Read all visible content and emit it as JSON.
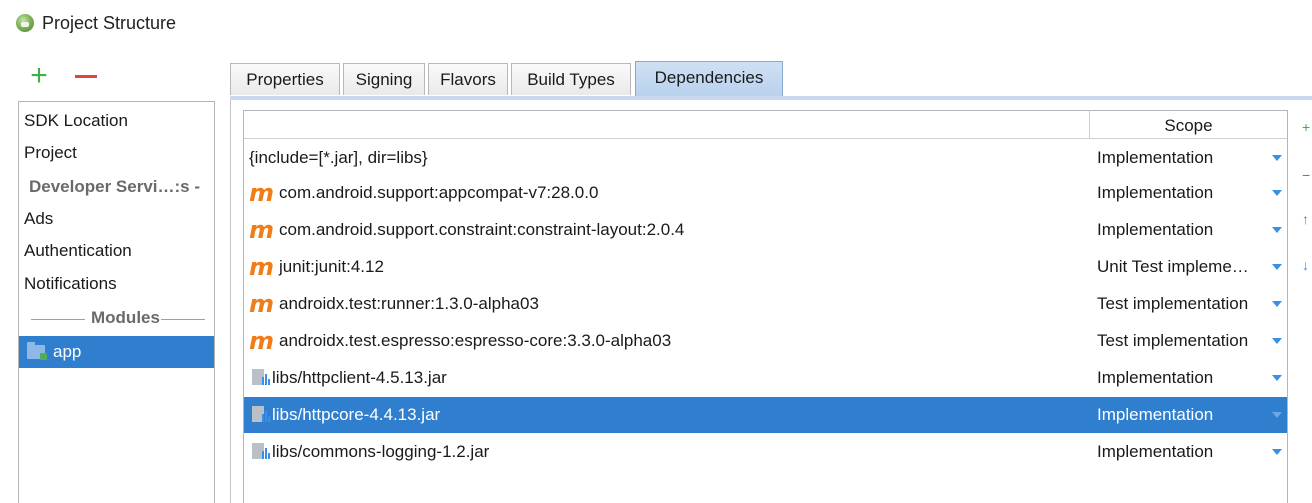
{
  "window": {
    "title": "Project Structure"
  },
  "left_toolbar": {
    "add_symbol": "+",
    "remove_symbol": "−"
  },
  "sidebar": {
    "items": [
      {
        "label": "SDK Location"
      },
      {
        "label": "Project"
      }
    ],
    "group": {
      "label": "Developer Servi…:s -"
    },
    "service_items": [
      {
        "label": "Ads"
      },
      {
        "label": "Authentication"
      },
      {
        "label": "Notifications"
      }
    ],
    "modules_label": "Modules",
    "modules": [
      {
        "label": "app",
        "selected": true
      }
    ]
  },
  "tabs": [
    {
      "label": "Properties",
      "active": false
    },
    {
      "label": "Signing",
      "active": false
    },
    {
      "label": "Flavors",
      "active": false
    },
    {
      "label": "Build Types",
      "active": false
    },
    {
      "label": "Dependencies",
      "active": true
    }
  ],
  "table": {
    "columns": {
      "name": "",
      "scope": "Scope"
    },
    "rows": [
      {
        "icon": "none",
        "name": "{include=[*.jar], dir=libs}",
        "scope": "Implementation",
        "selected": false
      },
      {
        "icon": "maven-icon",
        "name": "com.android.support:appcompat-v7:28.0.0",
        "scope": "Implementation",
        "selected": false
      },
      {
        "icon": "maven-icon",
        "name": "com.android.support.constraint:constraint-layout:2.0.4",
        "scope": "Implementation",
        "selected": false
      },
      {
        "icon": "maven-icon",
        "name": "junit:junit:4.12",
        "scope": "Unit Test impleme…",
        "selected": false
      },
      {
        "icon": "maven-icon",
        "name": "androidx.test:runner:1.3.0-alpha03",
        "scope": "Test implementation",
        "selected": false
      },
      {
        "icon": "maven-icon",
        "name": "androidx.test.espresso:espresso-core:3.3.0-alpha03",
        "scope": "Test implementation",
        "selected": false
      },
      {
        "icon": "jar-icon",
        "name": "libs/httpclient-4.5.13.jar",
        "scope": "Implementation",
        "selected": false
      },
      {
        "icon": "jar-icon",
        "name": "libs/httpcore-4.4.13.jar",
        "scope": "Implementation",
        "selected": true
      },
      {
        "icon": "jar-icon",
        "name": "libs/commons-logging-1.2.jar",
        "scope": "Implementation",
        "selected": false
      }
    ],
    "maven_glyph": "m"
  },
  "colors": {
    "selection": "#2f7fce",
    "active_tab": "#b9d1ee",
    "maven_orange": "#f07d18",
    "add_green": "#3fae49",
    "remove_red": "#e0463b"
  }
}
